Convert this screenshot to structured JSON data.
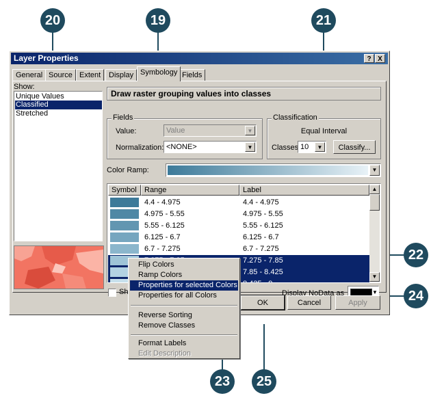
{
  "callouts": [
    "20",
    "19",
    "21",
    "22",
    "24",
    "23",
    "25"
  ],
  "window": {
    "title": "Layer Properties",
    "help": "?",
    "close": "X"
  },
  "tabs": [
    "General",
    "Source",
    "Extent",
    "Display",
    "Symbology",
    "Fields"
  ],
  "show": {
    "label": "Show:",
    "items": [
      "Unique Values",
      "Classified",
      "Stretched"
    ],
    "selected": "Classified"
  },
  "header_text": "Draw raster grouping values into classes",
  "fields": {
    "group_label": "Fields",
    "value_label": "Value:",
    "value": "Value",
    "normalization_label": "Normalization:",
    "normalization": "<NONE>"
  },
  "classification": {
    "group_label": "Classification",
    "method": "Equal Interval",
    "classes_label": "Classes:",
    "classes": "10",
    "classify_button": "Classify..."
  },
  "color_ramp_label": "Color Ramp:",
  "table": {
    "headers": [
      "Symbol",
      "Range",
      "Label"
    ],
    "rows": [
      {
        "range": "4.4 - 4.975",
        "label": "4.4 - 4.975",
        "color": "#3d7a99",
        "selected": false
      },
      {
        "range": "4.975 - 5.55",
        "label": "4.975 - 5.55",
        "color": "#4f88a5",
        "selected": false
      },
      {
        "range": "5.55 - 6.125",
        "label": "5.55 - 6.125",
        "color": "#6296b1",
        "selected": false
      },
      {
        "range": "6.125 - 6.7",
        "label": "6.125 - 6.7",
        "color": "#76a6bf",
        "selected": false
      },
      {
        "range": "6.7 - 7.275",
        "label": "6.7 - 7.275",
        "color": "#8bb6cc",
        "selected": false
      },
      {
        "range": "7.275 - 7.85",
        "label": "7.275 - 7.85",
        "color": "#9ec4d7",
        "selected": true
      },
      {
        "range": "7.85 - 8.425",
        "label": "7.85 - 8.425",
        "color": "#b2d2e2",
        "selected": true
      },
      {
        "range": "8.425 - 9",
        "label": "8.425 - 9",
        "color": "#c7e0ec",
        "selected": true
      }
    ]
  },
  "show_class_breaks_prefix": "Sh",
  "nodata_label": "Display NoData as",
  "buttons": {
    "ok": "OK",
    "cancel": "Cancel",
    "apply": "Apply"
  },
  "context_menu": {
    "items": [
      {
        "label": "Flip Colors",
        "state": "normal"
      },
      {
        "label": "Ramp Colors",
        "state": "normal"
      },
      {
        "label": "Properties for selected Colors",
        "state": "highlighted"
      },
      {
        "label": "Properties for all Colors",
        "state": "normal"
      },
      {
        "label": "Reverse Sorting",
        "state": "normal"
      },
      {
        "label": "Remove Classes",
        "state": "normal"
      },
      {
        "label": "Format Labels",
        "state": "normal"
      },
      {
        "label": "Edit Description",
        "state": "disabled"
      }
    ]
  },
  "colors": {
    "callout": "#1f4a5e",
    "selection": "#0a246a",
    "ramp_start": "#3d7a99",
    "ramp_end": "#e8f2f7",
    "preview": "#ef6a5a"
  }
}
